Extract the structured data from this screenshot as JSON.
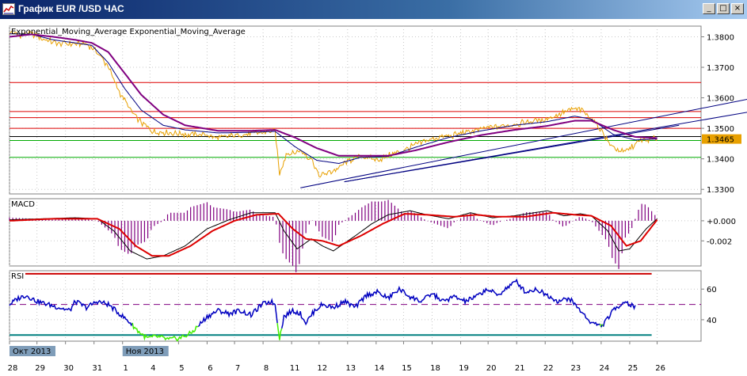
{
  "window": {
    "title": "График EUR /USD ЧАС",
    "buttons": {
      "minimize": "_",
      "maximize": "□",
      "close": "×"
    }
  },
  "colors": {
    "price": "#e8a000",
    "ema_fast": "#000080",
    "ema_slow": "#800080",
    "hline_red": "#dd0000",
    "hline_green": "#00aa00",
    "hline_black": "#000000",
    "trend": "#000080",
    "macd_hist": "#800080",
    "macd_line": "#000000",
    "macd_signal": "#dd0000",
    "rsi_line": "#0000c0",
    "rsi_low": "#44ee00",
    "rsi_upper": "#cc0000",
    "rsi_lower": "#008080",
    "rsi_mid": "#800080",
    "last_price_bg": "#e8a000"
  },
  "chart_data": [
    {
      "type": "line",
      "title": "Exponential_Moving_Average Exponential_Moving_Average",
      "ylim": [
        1.3285,
        1.3835
      ],
      "yticks": [
        "1.3800",
        "1.3700",
        "1.3600",
        "1.3500",
        "1.3400",
        "1.3300"
      ],
      "ytick_values": [
        1.38,
        1.37,
        1.36,
        1.35,
        1.34,
        1.33
      ],
      "last_price": "1.3465",
      "series_keypoints": [
        [
          0,
          1.3815
        ],
        [
          10,
          1.3805
        ],
        [
          20,
          1.381
        ],
        [
          30,
          1.3795
        ],
        [
          40,
          1.3782
        ],
        [
          55,
          1.3776
        ],
        [
          68,
          1.3778
        ],
        [
          78,
          1.376
        ],
        [
          90,
          1.37
        ],
        [
          100,
          1.362
        ],
        [
          115,
          1.3535
        ],
        [
          130,
          1.349
        ],
        [
          145,
          1.3485
        ],
        [
          160,
          1.348
        ],
        [
          180,
          1.3478
        ],
        [
          190,
          1.3468
        ],
        [
          200,
          1.3475
        ],
        [
          215,
          1.348
        ],
        [
          230,
          1.3487
        ],
        [
          242,
          1.3492
        ],
        [
          246,
          1.335
        ],
        [
          252,
          1.3415
        ],
        [
          265,
          1.3425
        ],
        [
          275,
          1.34
        ],
        [
          282,
          1.3345
        ],
        [
          295,
          1.336
        ],
        [
          310,
          1.3395
        ],
        [
          320,
          1.341
        ],
        [
          335,
          1.3395
        ],
        [
          345,
          1.341
        ],
        [
          360,
          1.343
        ],
        [
          372,
          1.345
        ],
        [
          390,
          1.347
        ],
        [
          405,
          1.3478
        ],
        [
          420,
          1.349
        ],
        [
          440,
          1.3505
        ],
        [
          455,
          1.351
        ],
        [
          470,
          1.352
        ],
        [
          485,
          1.3528
        ],
        [
          500,
          1.3545
        ],
        [
          515,
          1.3565
        ],
        [
          520,
          1.356
        ],
        [
          528,
          1.354
        ],
        [
          540,
          1.349
        ],
        [
          548,
          1.344
        ],
        [
          560,
          1.342
        ],
        [
          575,
          1.346
        ],
        [
          590,
          1.3465
        ]
      ],
      "ema_fast_keypoints": [
        [
          0,
          1.381
        ],
        [
          20,
          1.3808
        ],
        [
          40,
          1.379
        ],
        [
          60,
          1.378
        ],
        [
          75,
          1.3772
        ],
        [
          90,
          1.3715
        ],
        [
          105,
          1.363
        ],
        [
          120,
          1.356
        ],
        [
          140,
          1.351
        ],
        [
          160,
          1.3495
        ],
        [
          190,
          1.3485
        ],
        [
          220,
          1.3487
        ],
        [
          242,
          1.349
        ],
        [
          260,
          1.344
        ],
        [
          280,
          1.3395
        ],
        [
          300,
          1.3385
        ],
        [
          320,
          1.3405
        ],
        [
          345,
          1.3408
        ],
        [
          370,
          1.3438
        ],
        [
          400,
          1.347
        ],
        [
          430,
          1.3492
        ],
        [
          460,
          1.351
        ],
        [
          490,
          1.3522
        ],
        [
          515,
          1.354
        ],
        [
          530,
          1.353
        ],
        [
          550,
          1.348
        ],
        [
          570,
          1.3462
        ],
        [
          590,
          1.3465
        ]
      ],
      "ema_slow_keypoints": [
        [
          0,
          1.38
        ],
        [
          20,
          1.3808
        ],
        [
          40,
          1.38
        ],
        [
          60,
          1.379
        ],
        [
          75,
          1.378
        ],
        [
          90,
          1.375
        ],
        [
          105,
          1.368
        ],
        [
          120,
          1.361
        ],
        [
          140,
          1.3545
        ],
        [
          160,
          1.351
        ],
        [
          190,
          1.3492
        ],
        [
          220,
          1.3492
        ],
        [
          242,
          1.3495
        ],
        [
          260,
          1.347
        ],
        [
          280,
          1.3435
        ],
        [
          300,
          1.341
        ],
        [
          320,
          1.341
        ],
        [
          345,
          1.341
        ],
        [
          370,
          1.3428
        ],
        [
          400,
          1.3455
        ],
        [
          430,
          1.3478
        ],
        [
          460,
          1.3495
        ],
        [
          490,
          1.3508
        ],
        [
          515,
          1.3525
        ],
        [
          530,
          1.3525
        ],
        [
          550,
          1.3495
        ],
        [
          570,
          1.3472
        ],
        [
          590,
          1.3468
        ]
      ],
      "hlines": [
        {
          "y": 1.365,
          "color": "red"
        },
        {
          "y": 1.3555,
          "color": "red"
        },
        {
          "y": 1.3535,
          "color": "red"
        },
        {
          "y": 1.35,
          "color": "red"
        },
        {
          "y": 1.3473,
          "color": "black"
        },
        {
          "y": 1.346,
          "color": "green"
        },
        {
          "y": 1.3405,
          "color": "green"
        }
      ],
      "trendlines": [
        {
          "x1": 265,
          "y1": 1.3305,
          "x2": 700,
          "y2": 1.3615
        },
        {
          "x1": 305,
          "y1": 1.3325,
          "x2": 610,
          "y2": 1.351
        },
        {
          "x1": 305,
          "y1": 1.3325,
          "x2": 700,
          "y2": 1.357
        }
      ]
    },
    {
      "type": "bar",
      "title": "MACD",
      "ylim": [
        -0.0045,
        0.0022
      ],
      "yticks": [
        "+0.000",
        "-0.002"
      ],
      "ytick_values": [
        0.0,
        -0.002
      ],
      "macd_keypoints": [
        [
          0,
          0.0001
        ],
        [
          30,
          0.0002
        ],
        [
          60,
          0.0003
        ],
        [
          80,
          0.0002
        ],
        [
          95,
          -0.001
        ],
        [
          110,
          -0.003
        ],
        [
          125,
          -0.0038
        ],
        [
          140,
          -0.0035
        ],
        [
          160,
          -0.0025
        ],
        [
          180,
          -0.0008
        ],
        [
          200,
          0.0001
        ],
        [
          220,
          0.0008
        ],
        [
          242,
          0.0008
        ],
        [
          250,
          -0.001
        ],
        [
          262,
          -0.0028
        ],
        [
          275,
          -0.0018
        ],
        [
          285,
          -0.0025
        ],
        [
          295,
          -0.003
        ],
        [
          315,
          -0.0015
        ],
        [
          330,
          -0.0003
        ],
        [
          345,
          0.0006
        ],
        [
          365,
          0.001
        ],
        [
          380,
          0.0006
        ],
        [
          400,
          0.0002
        ],
        [
          420,
          0.0008
        ],
        [
          440,
          0.0003
        ],
        [
          460,
          0.0005
        ],
        [
          490,
          0.001
        ],
        [
          505,
          0.0005
        ],
        [
          520,
          0.0007
        ],
        [
          530,
          0.0005
        ],
        [
          545,
          -0.001
        ],
        [
          555,
          -0.003
        ],
        [
          565,
          -0.0028
        ],
        [
          580,
          -0.0008
        ],
        [
          590,
          0.0002
        ]
      ],
      "signal_keypoints": [
        [
          0,
          0.0
        ],
        [
          40,
          0.0002
        ],
        [
          80,
          0.0002
        ],
        [
          100,
          -0.0008
        ],
        [
          115,
          -0.0025
        ],
        [
          130,
          -0.0035
        ],
        [
          145,
          -0.0035
        ],
        [
          165,
          -0.0025
        ],
        [
          185,
          -0.001
        ],
        [
          205,
          0.0
        ],
        [
          225,
          0.0006
        ],
        [
          245,
          0.0007
        ],
        [
          258,
          -0.0008
        ],
        [
          270,
          -0.0018
        ],
        [
          285,
          -0.002
        ],
        [
          300,
          -0.0025
        ],
        [
          320,
          -0.0015
        ],
        [
          340,
          -0.0003
        ],
        [
          360,
          0.0007
        ],
        [
          380,
          0.0006
        ],
        [
          405,
          0.0004
        ],
        [
          425,
          0.0006
        ],
        [
          445,
          0.0004
        ],
        [
          470,
          0.0004
        ],
        [
          495,
          0.0008
        ],
        [
          515,
          0.0006
        ],
        [
          530,
          0.0005
        ],
        [
          548,
          -0.0005
        ],
        [
          562,
          -0.0025
        ],
        [
          575,
          -0.002
        ],
        [
          590,
          0.0001
        ]
      ]
    },
    {
      "type": "line",
      "title": "RSI",
      "ylim": [
        26,
        72
      ],
      "yticks": [
        "60",
        "40"
      ],
      "ytick_values": [
        60,
        40
      ],
      "levels": {
        "upper": 70,
        "middle": 50,
        "lower": 30
      },
      "rsi_keypoints": [
        [
          0,
          50
        ],
        [
          8,
          54
        ],
        [
          15,
          56
        ],
        [
          25,
          52
        ],
        [
          35,
          50
        ],
        [
          45,
          48
        ],
        [
          55,
          46
        ],
        [
          60,
          52
        ],
        [
          70,
          48
        ],
        [
          80,
          52
        ],
        [
          90,
          50
        ],
        [
          100,
          44
        ],
        [
          110,
          38
        ],
        [
          118,
          32
        ],
        [
          125,
          28
        ],
        [
          135,
          29
        ],
        [
          145,
          27
        ],
        [
          155,
          28
        ],
        [
          165,
          31
        ],
        [
          172,
          36
        ],
        [
          180,
          42
        ],
        [
          190,
          46
        ],
        [
          200,
          44
        ],
        [
          210,
          46
        ],
        [
          220,
          43
        ],
        [
          230,
          50
        ],
        [
          238,
          52
        ],
        [
          242,
          50
        ],
        [
          246,
          28
        ],
        [
          250,
          42
        ],
        [
          258,
          46
        ],
        [
          265,
          44
        ],
        [
          270,
          38
        ],
        [
          278,
          46
        ],
        [
          285,
          50
        ],
        [
          295,
          48
        ],
        [
          305,
          52
        ],
        [
          315,
          48
        ],
        [
          325,
          56
        ],
        [
          335,
          58
        ],
        [
          345,
          54
        ],
        [
          355,
          60
        ],
        [
          365,
          55
        ],
        [
          375,
          52
        ],
        [
          385,
          57
        ],
        [
          395,
          52
        ],
        [
          405,
          55
        ],
        [
          415,
          52
        ],
        [
          425,
          55
        ],
        [
          435,
          60
        ],
        [
          445,
          56
        ],
        [
          455,
          62
        ],
        [
          462,
          65
        ],
        [
          470,
          58
        ],
        [
          480,
          60
        ],
        [
          490,
          56
        ],
        [
          500,
          52
        ],
        [
          510,
          54
        ],
        [
          520,
          46
        ],
        [
          530,
          38
        ],
        [
          540,
          36
        ],
        [
          550,
          46
        ],
        [
          560,
          52
        ],
        [
          570,
          48
        ]
      ]
    }
  ],
  "x_axis": {
    "labels": [
      {
        "text": "28",
        "i": 0
      },
      {
        "text": "29",
        "i": 25
      },
      {
        "text": "30",
        "i": 51
      },
      {
        "text": "31",
        "i": 77
      },
      {
        "text": "1",
        "i": 103
      },
      {
        "text": "4",
        "i": 128
      },
      {
        "text": "5",
        "i": 154
      },
      {
        "text": "6",
        "i": 180
      },
      {
        "text": "7",
        "i": 205
      },
      {
        "text": "8",
        "i": 231
      },
      {
        "text": "11",
        "i": 257
      },
      {
        "text": "12",
        "i": 282
      },
      {
        "text": "13",
        "i": 308
      },
      {
        "text": "14",
        "i": 334
      },
      {
        "text": "15",
        "i": 359
      },
      {
        "text": "18",
        "i": 385
      },
      {
        "text": "19",
        "i": 411
      },
      {
        "text": "20",
        "i": 436
      },
      {
        "text": "21",
        "i": 462
      },
      {
        "text": "22",
        "i": 488
      },
      {
        "text": "23",
        "i": 513
      },
      {
        "text": "24",
        "i": 539
      },
      {
        "text": "25",
        "i": 565
      },
      {
        "text": "26",
        "i": 590
      }
    ],
    "badges": [
      {
        "text": "Окт 2013",
        "i": 0
      },
      {
        "text": "Ноя 2013",
        "i": 103
      }
    ]
  }
}
